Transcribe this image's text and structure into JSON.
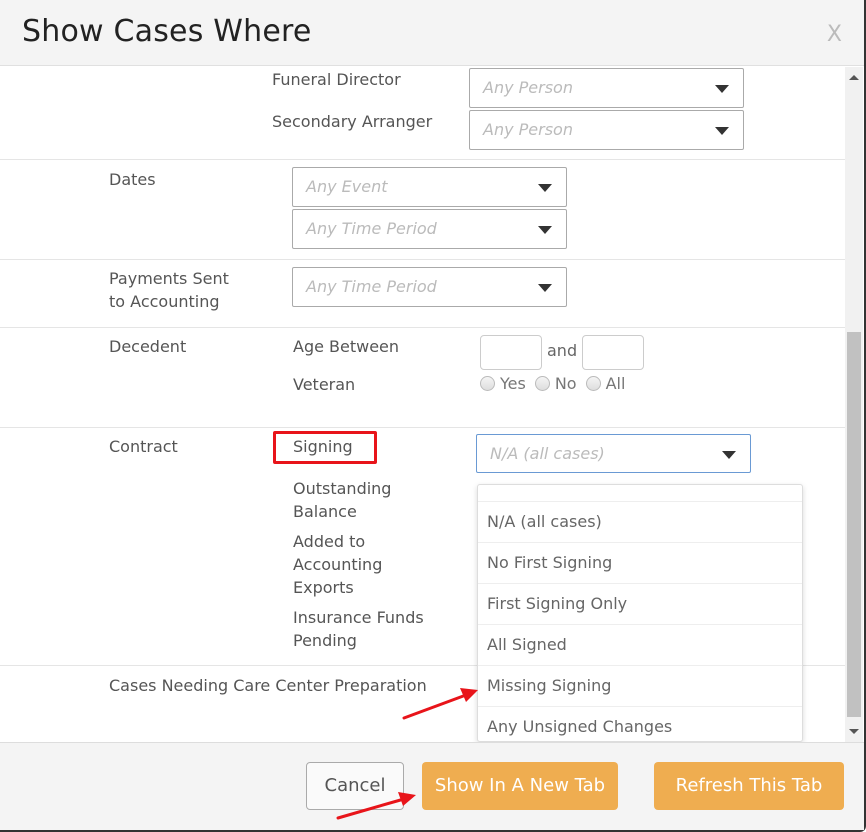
{
  "modal": {
    "title": "Show Cases Where",
    "close_label": "X"
  },
  "people": {
    "funeral_director_label": "Funeral Director",
    "funeral_director_value": "Any Person",
    "secondary_arranger_label": "Secondary Arranger",
    "secondary_arranger_value": "Any Person"
  },
  "dates": {
    "label": "Dates",
    "event_value": "Any Event",
    "period_value": "Any Time Period"
  },
  "payments": {
    "label": "Payments Sent to Accounting",
    "label_line1": "Payments Sent",
    "label_line2": "to Accounting",
    "period_value": "Any Time Period"
  },
  "decedent": {
    "label": "Decedent",
    "age_label": "Age Between",
    "age_from": "",
    "and_label": "and",
    "age_to": "",
    "veteran_label": "Veteran",
    "veteran_options": [
      "Yes",
      "No",
      "All"
    ]
  },
  "contract": {
    "label": "Contract",
    "signing_label": "Signing",
    "signing_value": "N/A (all cases)",
    "outstanding_line1": "Outstanding",
    "outstanding_line2": "Balance",
    "added_line1": "Added to",
    "added_line2": "Accounting",
    "added_line3": "Exports",
    "insurance_line1": "Insurance Funds",
    "insurance_line2": "Pending"
  },
  "care_center": {
    "label": "Cases Needing Care Center Preparation"
  },
  "signing_dropdown": {
    "options": [
      "N/A (all cases)",
      "No First Signing",
      "First Signing Only",
      "All Signed",
      "Missing Signing",
      "Any Unsigned Changes"
    ]
  },
  "footer": {
    "cancel_label": "Cancel",
    "new_tab_label": "Show In A New Tab",
    "refresh_label": "Refresh This Tab"
  },
  "colors": {
    "accent": "#efad50",
    "annotation": "#e8141a"
  }
}
